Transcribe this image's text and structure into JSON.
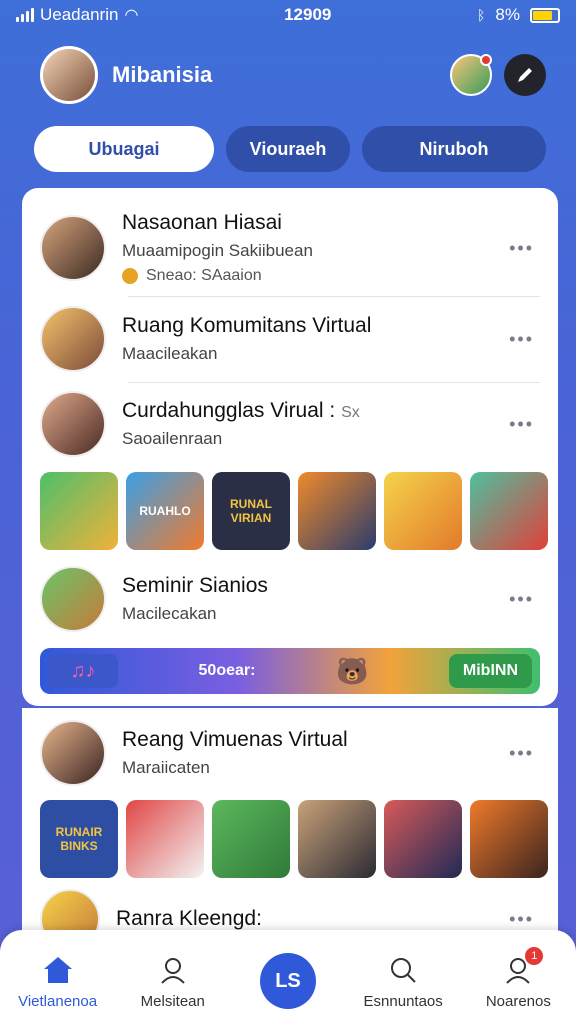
{
  "status": {
    "carrier": "Ueadanrin",
    "time": "12909",
    "battery": "8%"
  },
  "header": {
    "title": "Mibanisia"
  },
  "tabs": [
    {
      "label": "Ubuagai"
    },
    {
      "label": "Viouraeh"
    },
    {
      "label": "Niruboh"
    }
  ],
  "feed": [
    {
      "name": "Nasaonan Hiasai",
      "sub": "Muaamipogin Sakiibuean",
      "meta": "Sneao: SAaaion"
    },
    {
      "name": "Ruang Komumitans Virtual",
      "sub": "Maacileakan"
    },
    {
      "name": "Curdahungglas Virual",
      "sub": "Saoailenraan",
      "extra": "Sx"
    },
    {
      "name": "Seminir Sianios",
      "sub": "Macilecakan"
    }
  ],
  "strip1": [
    "",
    "RUAHLO",
    "RUNAL VIRIAN",
    "",
    "",
    ""
  ],
  "banner": {
    "text": "50oear:",
    "button": "MibINN"
  },
  "feed2": [
    {
      "name": "Reang Vimuenas Virtual",
      "sub": "Maraiicaten"
    },
    {
      "name": "Ranra Kleengd:"
    }
  ],
  "strip2": [
    "RUNAIR BINKS",
    "",
    "",
    "",
    "",
    ""
  ],
  "bottom_nav": [
    {
      "label": "Vietlanenoa"
    },
    {
      "label": "Melsitean"
    },
    {
      "label": "LS"
    },
    {
      "label": "Esnnuntaos"
    },
    {
      "label": "Noarenos",
      "badge": "1"
    }
  ]
}
